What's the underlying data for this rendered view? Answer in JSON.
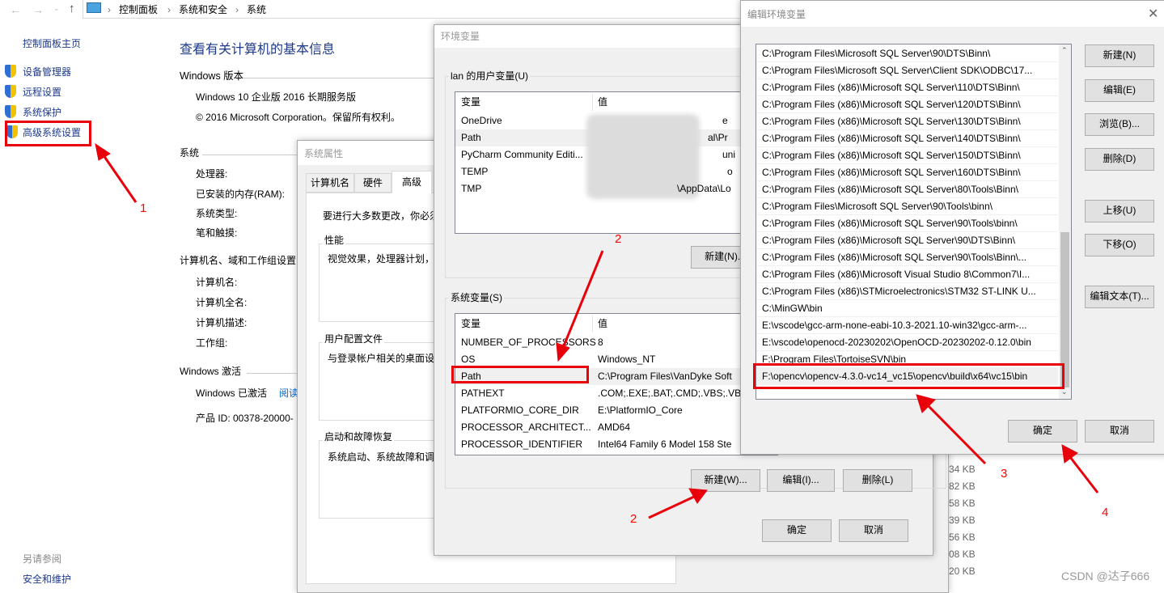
{
  "explorer": {
    "breadcrumb": [
      "控制面板",
      "系统和安全",
      "系统"
    ],
    "sidebar": {
      "home": "控制面板主页",
      "items": [
        "设备管理器",
        "远程设置",
        "系统保护",
        "高级系统设置"
      ],
      "see_also": "另请参阅",
      "security": "安全和维护"
    },
    "title": "查看有关计算机的基本信息",
    "win_version_heading": "Windows 版本",
    "edition": "Windows 10 企业版 2016 长期服务版",
    "copyright": "© 2016 Microsoft Corporation。保留所有权利。",
    "system_heading": "系统",
    "system_labels": [
      "处理器:",
      "已安装的内存(RAM):",
      "系统类型:",
      "笔和触摸:"
    ],
    "computer_heading": "计算机名、域和工作组设置",
    "computer_labels": [
      "计算机名:",
      "计算机全名:",
      "计算机描述:",
      "工作组:"
    ],
    "activation_heading": "Windows 激活",
    "activated": "Windows 已激活",
    "read_link": "阅读",
    "product_id": "产品 ID: 00378-20000-"
  },
  "sysprops": {
    "title": "系统属性",
    "tabs": [
      "计算机名",
      "硬件",
      "高级"
    ],
    "admin_note": "要进行大多数更改，你必须",
    "perf": {
      "label": "性能",
      "desc": "视觉效果，处理器计划，"
    },
    "profile": {
      "label": "用户配置文件",
      "desc": "与登录帐户相关的桌面设"
    },
    "startup": {
      "label": "启动和故障恢复",
      "desc": "系统启动、系统故障和调"
    }
  },
  "envvars": {
    "title": "环境变量",
    "user_group": "lan 的用户变量(U)",
    "col_var": "变量",
    "col_val": "值",
    "user_vars": [
      {
        "name": "OneDrive",
        "value": "e"
      },
      {
        "name": "Path",
        "value": "al\\Pr"
      },
      {
        "name": "PyCharm Community Editi...",
        "value": "uni"
      },
      {
        "name": "TEMP",
        "value": "o"
      },
      {
        "name": "TMP",
        "value": "\\AppData\\Lo"
      }
    ],
    "user_new": "新建(N)...",
    "sys_group": "系统变量(S)",
    "sys_vars": [
      {
        "name": "NUMBER_OF_PROCESSORS",
        "value": "8"
      },
      {
        "name": "OS",
        "value": "Windows_NT"
      },
      {
        "name": "Path",
        "value": "C:\\Program Files\\VanDyke Soft"
      },
      {
        "name": "PATHEXT",
        "value": ".COM;.EXE;.BAT;.CMD;.VBS;.VB"
      },
      {
        "name": "PLATFORMIO_CORE_DIR",
        "value": "E:\\PlatformIO_Core"
      },
      {
        "name": "PROCESSOR_ARCHITECT...",
        "value": "AMD64"
      },
      {
        "name": "PROCESSOR_IDENTIFIER",
        "value": "Intel64 Family 6 Model 158 Ste"
      }
    ],
    "sys_new": "新建(W)...",
    "sys_edit": "编辑(I)...",
    "sys_delete": "删除(L)",
    "ok": "确定",
    "cancel": "取消"
  },
  "editenv": {
    "title": "编辑环境变量",
    "entries": [
      "C:\\Program Files\\Microsoft SQL Server\\90\\DTS\\Binn\\",
      "C:\\Program Files\\Microsoft SQL Server\\Client SDK\\ODBC\\17...",
      "C:\\Program Files (x86)\\Microsoft SQL Server\\110\\DTS\\Binn\\",
      "C:\\Program Files (x86)\\Microsoft SQL Server\\120\\DTS\\Binn\\",
      "C:\\Program Files (x86)\\Microsoft SQL Server\\130\\DTS\\Binn\\",
      "C:\\Program Files (x86)\\Microsoft SQL Server\\140\\DTS\\Binn\\",
      "C:\\Program Files (x86)\\Microsoft SQL Server\\150\\DTS\\Binn\\",
      "C:\\Program Files (x86)\\Microsoft SQL Server\\160\\DTS\\Binn\\",
      "C:\\Program Files (x86)\\Microsoft SQL Server\\80\\Tools\\Binn\\",
      "C:\\Program Files\\Microsoft SQL Server\\90\\Tools\\binn\\",
      "C:\\Program Files (x86)\\Microsoft SQL Server\\90\\Tools\\binn\\",
      "C:\\Program Files (x86)\\Microsoft SQL Server\\90\\DTS\\Binn\\",
      "C:\\Program Files (x86)\\Microsoft SQL Server\\90\\Tools\\Binn\\...",
      "C:\\Program Files (x86)\\Microsoft Visual Studio 8\\Common7\\I...",
      "C:\\Program Files (x86)\\STMicroelectronics\\STM32 ST-LINK U...",
      "C:\\MinGW\\bin",
      "E:\\vscode\\gcc-arm-none-eabi-10.3-2021.10-win32\\gcc-arm-...",
      "E:\\vscode\\openocd-20230202\\OpenOCD-20230202-0.12.0\\bin",
      "F:\\Program Files\\TortoiseSVN\\bin",
      "F:\\opencv\\opencv-4.3.0-vc14_vc15\\opencv\\build\\x64\\vc15\\bin"
    ],
    "buttons": [
      "新建(N)",
      "编辑(E)",
      "浏览(B)...",
      "删除(D)",
      "上移(U)",
      "下移(O)",
      "编辑文本(T)..."
    ],
    "ok": "确定",
    "cancel": "取消"
  },
  "file_sizes": [
    "34 KB",
    "82 KB",
    "58 KB",
    "39 KB",
    "56 KB",
    "08 KB",
    "20 KB"
  ],
  "annotations": [
    "1",
    "2",
    "2",
    "3",
    "4"
  ],
  "watermark": "CSDN @达子666",
  "colors": {
    "annotation": "#e8000b",
    "title_blue": "#1e3a8a",
    "link": "#0066cc",
    "dialog_bg": "#f0f0f0"
  }
}
